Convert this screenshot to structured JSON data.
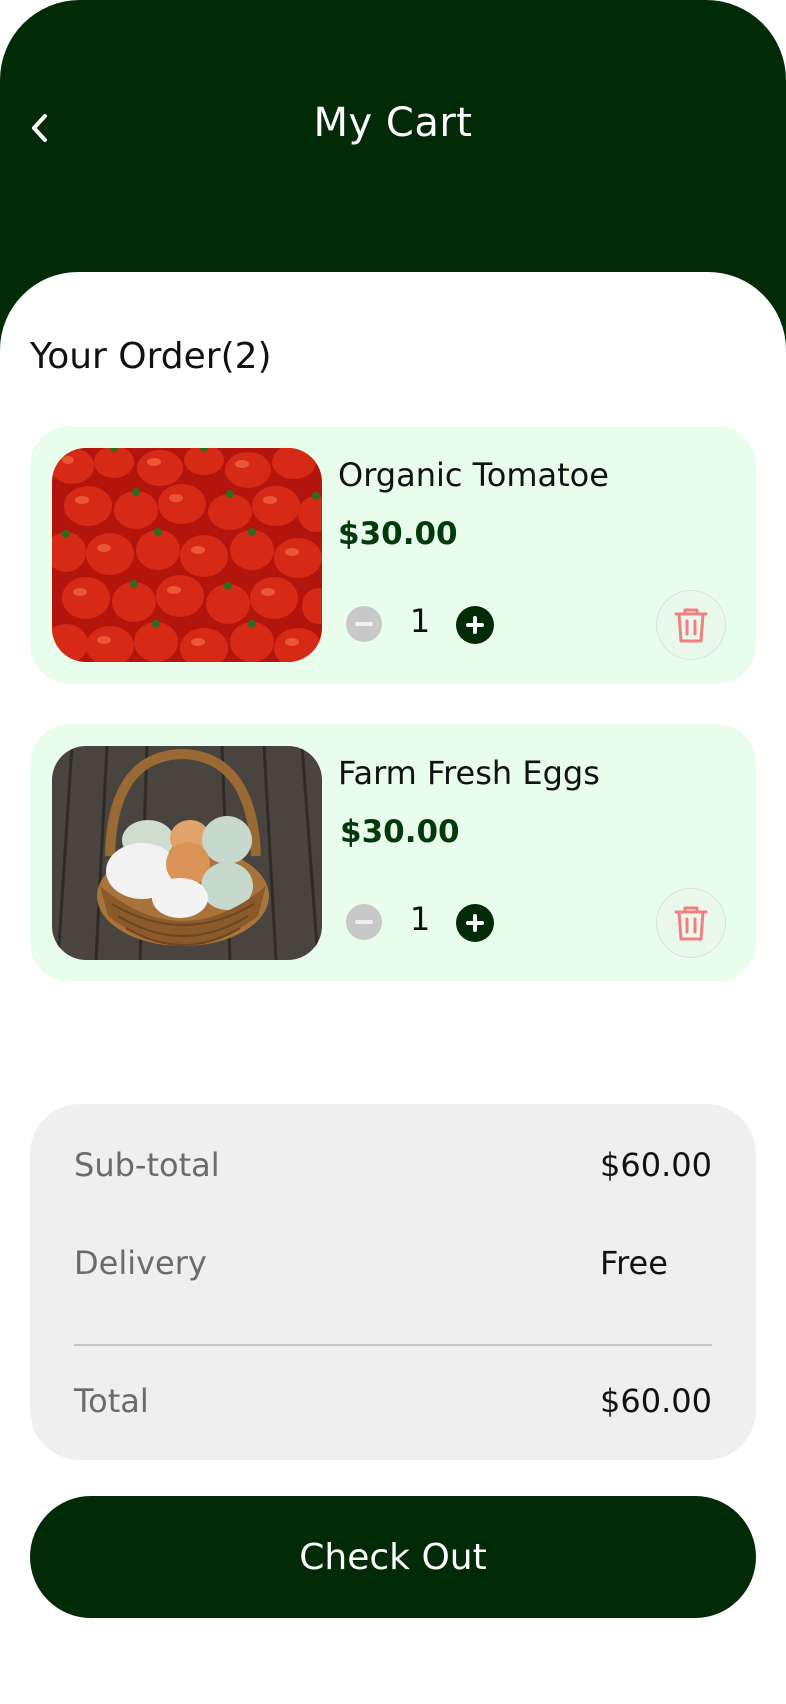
{
  "header": {
    "title": "My Cart",
    "back_icon": "chevron-left-icon"
  },
  "order": {
    "title": "Your Order(2)",
    "items": [
      {
        "name": "Organic Tomatoe",
        "price": "$30.00",
        "quantity": "1",
        "image": "tomatoes-photo"
      },
      {
        "name": "Farm Fresh Eggs",
        "price": "$30.00",
        "quantity": "1",
        "image": "eggs-basket-photo"
      }
    ]
  },
  "summary": {
    "subtotal_label": "Sub-total",
    "subtotal_value": "$60.00",
    "delivery_label": "Delivery",
    "delivery_value": "Free",
    "total_label": "Total",
    "total_value": "$60.00"
  },
  "checkout_label": "Check Out",
  "colors": {
    "brand_dark": "#012b07",
    "card_bg": "#e9fdec",
    "delete_red": "#f08080",
    "summary_bg": "#efefef"
  }
}
